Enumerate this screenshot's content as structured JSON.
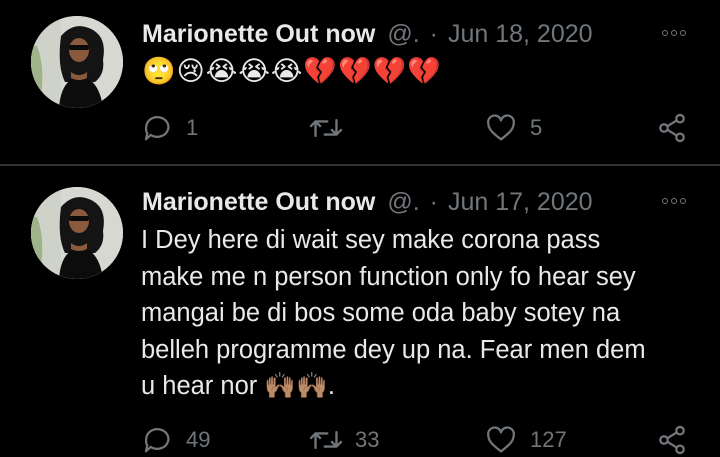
{
  "tweets": [
    {
      "name": "Marionette Out now",
      "handle": "@.",
      "separator": "·",
      "date": "Jun 18, 2020",
      "emoji_text": "🙄😢😭😭😭💔💔💔💔",
      "replies": "1",
      "retweets": "",
      "likes": "5"
    },
    {
      "name": "Marionette Out now",
      "handle": "@.",
      "separator": "·",
      "date": "Jun 17, 2020",
      "lines": [
        "I Dey here di wait sey make corona pass",
        "make me n person function only fo hear sey",
        "mangai be di bos some oda baby sotey na",
        "belleh programme dey up na. Fear men dem",
        "u hear nor 🙌🏽🙌🏽."
      ],
      "replies": "49",
      "retweets": "33",
      "likes": "127"
    }
  ],
  "colors": {
    "background": "#000000",
    "text": "#e7e9ea",
    "secondary": "#71767b",
    "divider": "#2f3336"
  },
  "icons": [
    "more-icon",
    "reply-icon",
    "retweet-icon",
    "like-icon",
    "share-icon"
  ]
}
